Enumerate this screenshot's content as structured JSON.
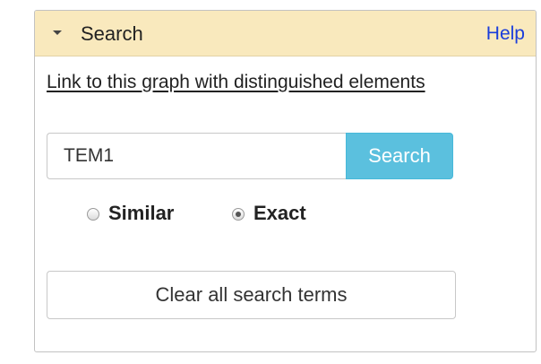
{
  "panel": {
    "title": "Search",
    "help_label": "Help",
    "collapse_icon": "caret-down-icon"
  },
  "graph_link": {
    "label": "Link to this graph with distinguished elements"
  },
  "search": {
    "value": "TEM1",
    "placeholder": "",
    "button_label": "Search",
    "button_color": "#5bc0de"
  },
  "match_mode": {
    "options": [
      {
        "label": "Similar",
        "selected": false
      },
      {
        "label": "Exact",
        "selected": true
      }
    ]
  },
  "clear_button": {
    "label": "Clear all search terms"
  },
  "colors": {
    "header_background": "#f9e9bd",
    "help_link": "#1a3ddb"
  }
}
